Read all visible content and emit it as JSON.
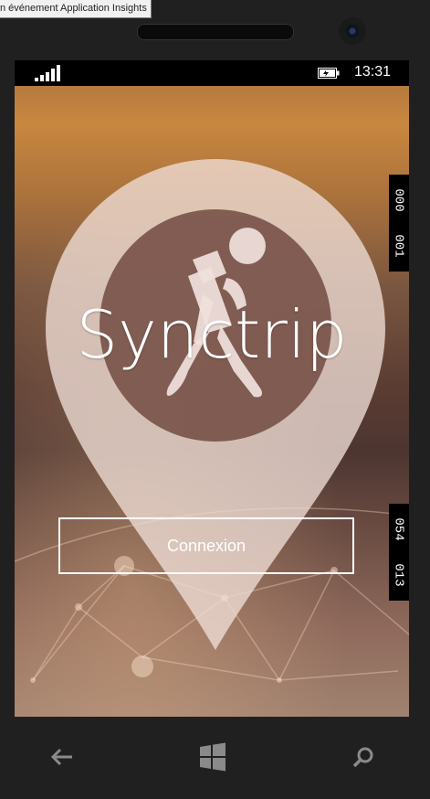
{
  "tooltip": {
    "text": "n événement Application Insights"
  },
  "statusbar": {
    "time": "13:31"
  },
  "app": {
    "title": "Synctrip",
    "login_label": "Connexion"
  },
  "debug_counters": {
    "top": [
      "000",
      "001"
    ],
    "bottom": [
      "054",
      "013"
    ]
  },
  "icons": {
    "signal": "signal-bars-icon",
    "battery": "battery-charging-icon",
    "back": "back-arrow-icon",
    "windows": "windows-logo-icon",
    "search": "search-icon"
  }
}
